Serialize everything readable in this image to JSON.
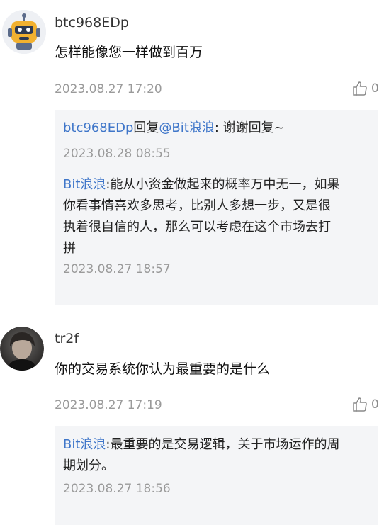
{
  "comments": [
    {
      "username": "btc968EDp",
      "content": "怎样能像您一样做到百万",
      "timestamp": "2023.08.27 17:20",
      "likes": "0",
      "avatar_icon": "robot-avatar-icon",
      "replies": [
        {
          "author": "btc968EDp",
          "action": "回复",
          "mention": "@Bit浪浪",
          "colon": ":",
          "text": " 谢谢回复~",
          "timestamp": "2023.08.28 08:55"
        },
        {
          "author": "Bit浪浪",
          "colon": ":",
          "text_lines": [
            "能从小资金做起来的概率万中无一，如果",
            "你看事情喜欢多思考，比别人多想一步，又是很",
            "执着很自信的人，那么可以考虑在这个市场去打",
            "拼"
          ],
          "timestamp": "2023.08.27 18:57"
        }
      ]
    },
    {
      "username": "tr2f",
      "content": "你的交易系统你认为最重要的是什么",
      "timestamp": "2023.08.27 17:19",
      "likes": "0",
      "avatar_icon": "dark-portrait-avatar-icon",
      "replies": [
        {
          "author": "Bit浪浪",
          "colon": ":",
          "text_lines": [
            "最重要的是交易逻辑，关于市场运作的周",
            "期划分。"
          ],
          "timestamp": "2023.08.27 18:56"
        }
      ]
    }
  ],
  "colors": {
    "accent": "#3f76c9",
    "muted": "#9a9a9a",
    "reply_bg": "#f4f5f7"
  }
}
